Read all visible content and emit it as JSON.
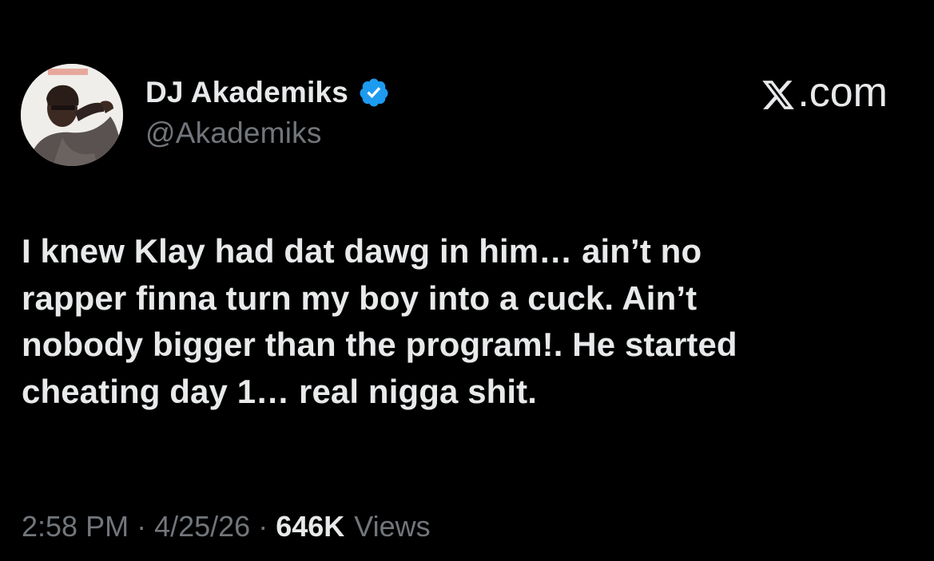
{
  "author": {
    "display_name": "DJ Akademiks",
    "handle": "@Akademiks",
    "verified": true,
    "verified_color": "#1d9bf0"
  },
  "brand": {
    "label": ".com",
    "icon": "x-logo-icon"
  },
  "tweet": {
    "text": "I knew Klay had dat dawg in him… ain’t no\nrapper finna turn my boy into a cuck. Ain’t\nnobody bigger than the program!. He started\ncheating day 1… real nigga shit."
  },
  "meta": {
    "time": "2:58 PM",
    "separator": "·",
    "date": "4/25/26",
    "views_count": "646K",
    "views_label": "Views"
  },
  "colors": {
    "background": "#000000",
    "primary_text": "#e7e9ea",
    "secondary_text": "#71767b"
  }
}
